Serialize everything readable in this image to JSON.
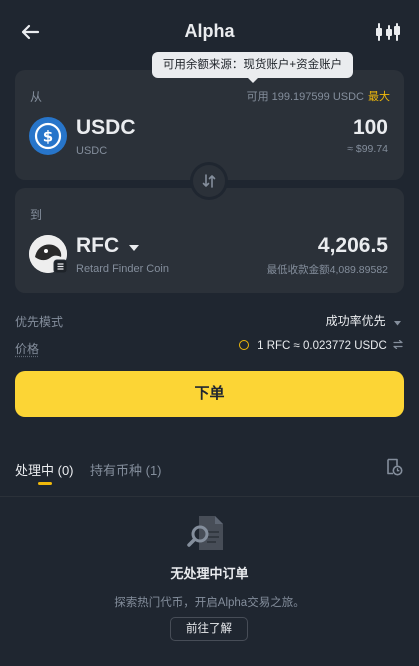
{
  "header": {
    "title": "Alpha",
    "back_icon": "arrow-left-icon",
    "settings_icon": "candlestick-settings-icon"
  },
  "tooltip": {
    "text": "可用余额来源：现货账户+资金账户"
  },
  "from": {
    "label": "从",
    "balance": "可用 199.197599 USDC",
    "max_label": "最大",
    "symbol": "USDC",
    "name": "USDC",
    "amount": "100",
    "usd_value": "≈ $99.74",
    "icon": "usdc-icon"
  },
  "swap_icon": "swap-arrows-icon",
  "to": {
    "label": "到",
    "symbol": "RFC",
    "name": "Retard Finder Coin",
    "amount": "4,206.5",
    "min_receive": "最低收款金额4,089.89582",
    "icon": "rfc-icon",
    "dropdown_icon": "caret-down-icon"
  },
  "priority": {
    "label": "优先模式",
    "value": "成功率优先"
  },
  "price": {
    "label": "价格",
    "value": "1 RFC ≈ 0.023772 USDC"
  },
  "order_button": "下单",
  "tabs": [
    {
      "label": "处理中 (0)",
      "active": true
    },
    {
      "label": "持有币种 (1)",
      "active": false
    }
  ],
  "empty": {
    "title": "无处理中订单",
    "desc": "探索热门代币，开启Alpha交易之旅。",
    "button": "前往了解"
  },
  "colors": {
    "background": "#1f2630",
    "card": "#2b3139",
    "accent": "#fcd535",
    "max": "#f0b90b",
    "usdc": "#2775ca"
  }
}
